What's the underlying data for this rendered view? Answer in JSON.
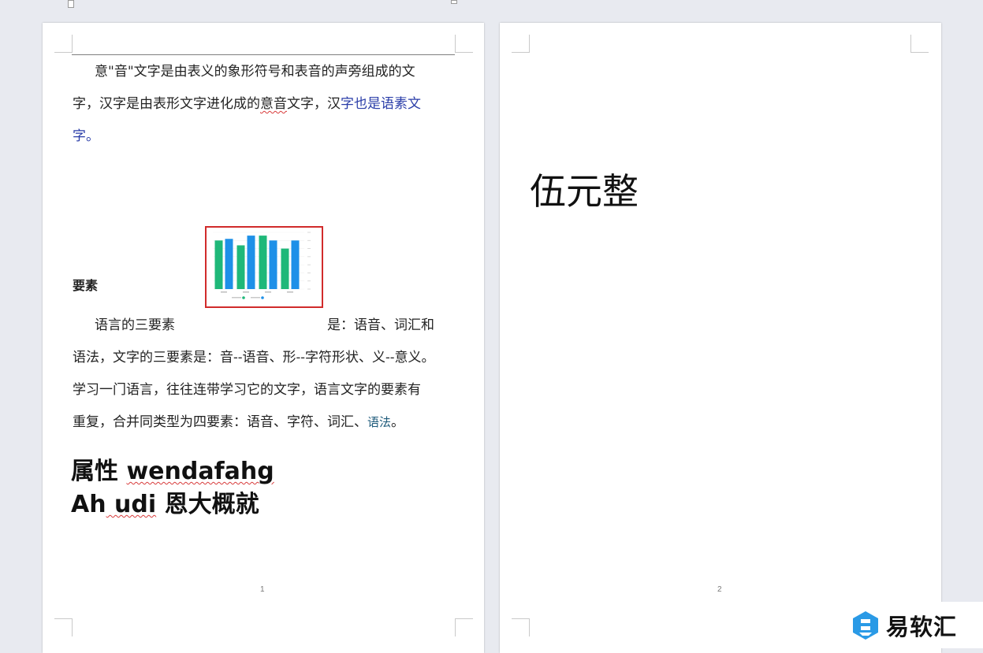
{
  "page1": {
    "para1": {
      "line1": "意\"音\"文字是由表义的象形符号和表音的声旁组成的文",
      "line2_a": "字，汉字是由表形文字进化成的",
      "line2_b": "意音",
      "line2_c": "文字，汉",
      "line2_d": "字也是语素文",
      "line3": "字。"
    },
    "heading": "要素",
    "para2": {
      "line1_a": "语言的三要素",
      "line1_b": "是：语音、词汇和",
      "line2": "语法，文字的三要素是：音--语音、形--字符形状、义--意义。",
      "line3": "学习一门语言，往往连带学习它的文字，语言文字的要素有",
      "line4_a": "重复，合并同类型为四要素：语音、字符、词汇、",
      "line4_b": "语法",
      "line4_c": "。"
    },
    "big1_a": "属性 ",
    "big1_b": "wendafahg",
    "big2_a": "Ah",
    "big2_b": " udi",
    "big2_c": " 恩大概就",
    "page_number": "1"
  },
  "page2": {
    "amount": "伍元整",
    "page_number": "2"
  },
  "watermark": {
    "text": "易软汇"
  },
  "chart_data": {
    "type": "bar",
    "categories": [
      "",
      "",
      "",
      ""
    ],
    "series": [
      {
        "name": "",
        "values": [
          60,
          54,
          66,
          50
        ]
      },
      {
        "name": "",
        "values": [
          62,
          66,
          60,
          60
        ]
      }
    ],
    "ylim": [
      0,
      70
    ],
    "colors": [
      "#1fb879",
      "#1e90e8"
    ],
    "legend": "bottom"
  }
}
